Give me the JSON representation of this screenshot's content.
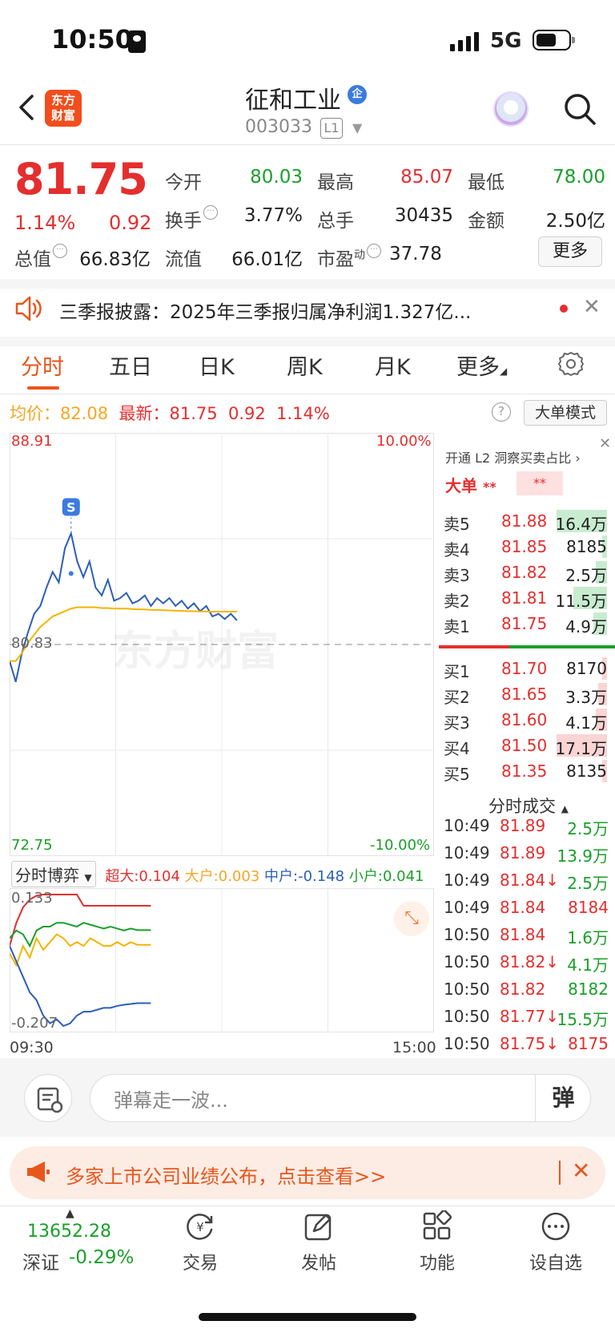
{
  "status_bar": {
    "time": "10:50",
    "network": "5G"
  },
  "header": {
    "brand": "东方财富",
    "stock_name": "征和工业",
    "ent_badge": "企",
    "stock_code": "003033",
    "level": "L1"
  },
  "quote": {
    "price": "81.75",
    "pct_change": "1.14%",
    "abs_change": "0.92",
    "open_label": "今开",
    "open": "80.03",
    "high_label": "最高",
    "high": "85.07",
    "low_label": "最低",
    "low": "78.00",
    "turnover_label": "换手",
    "turnover": "3.77%",
    "volume_label": "总手",
    "volume": "30435",
    "amount_label": "金额",
    "amount": "2.50亿",
    "mcap_label": "总值",
    "mcap": "66.83亿",
    "float_label": "流值",
    "float_cap": "66.01亿",
    "pe_label": "市盈",
    "pe_sup": "动",
    "pe": "37.78",
    "more_label": "更多"
  },
  "notice": {
    "text": "三季报披露：2025年三季报归属净利润1.327亿..."
  },
  "tabs": [
    {
      "label": "分时",
      "active": true
    },
    {
      "label": "五日"
    },
    {
      "label": "日K"
    },
    {
      "label": "周K"
    },
    {
      "label": "月K"
    },
    {
      "label": "更多"
    }
  ],
  "summary": {
    "avg_label": "均价：",
    "avg": "82.08",
    "latest_label": "最新：",
    "latest": "81.75",
    "latest_change": "0.92",
    "latest_pct": "1.14%",
    "help": "?",
    "bigorder_mode": "大单模式"
  },
  "chart_data": {
    "type": "line",
    "y_top": "88.91",
    "y_mid": "80.83",
    "y_bottom": "72.75",
    "pct_top": "10.00%",
    "pct_bottom": "-10.00%",
    "ylim": [
      72.75,
      88.91
    ],
    "marker": "S",
    "watermark": "东方财富",
    "series": [
      {
        "name": "price",
        "color": "#2b5eb7",
        "values": [
          80.2,
          79.4,
          80.5,
          81.3,
          82.0,
          82.3,
          83.0,
          83.6,
          83.2,
          84.5,
          85.07,
          84.0,
          83.4,
          84.0,
          83.0,
          82.7,
          83.3,
          82.5,
          82.6,
          82.8,
          82.4,
          82.5,
          82.7,
          82.3,
          82.6,
          82.4,
          82.6,
          82.3,
          82.5,
          82.2,
          82.4,
          82.1,
          82.3,
          81.9,
          82.0,
          81.8,
          82.0,
          81.75
        ]
      },
      {
        "name": "avg",
        "color": "#f5b400",
        "values": [
          80.2,
          80.2,
          80.5,
          80.9,
          81.2,
          81.5,
          81.7,
          81.9,
          82.0,
          82.1,
          82.2,
          82.25,
          82.25,
          82.25,
          82.25,
          82.22,
          82.22,
          82.2,
          82.2,
          82.2,
          82.18,
          82.17,
          82.17,
          82.15,
          82.15,
          82.14,
          82.13,
          82.12,
          82.11,
          82.1,
          82.1,
          82.09,
          82.09,
          82.08,
          82.08,
          82.08,
          82.08,
          82.08
        ]
      }
    ],
    "x_start": "09:30",
    "x_end": "15:00"
  },
  "flow": {
    "select": "分时博弈",
    "super_label": "超大:",
    "super": "0.104",
    "big_label": "大户:",
    "big": "0.003",
    "mid_label": "中户:",
    "mid": "-0.148",
    "small_label": "小户:",
    "small": "0.041",
    "y_top": "0.133",
    "y_bottom": "-0.207",
    "colors": {
      "super": "#e52e2e",
      "big": "#f5b400",
      "mid": "#2b5eb7",
      "small": "#1a9f2a"
    },
    "series": {
      "super": [
        0.0,
        0.06,
        0.1,
        0.12,
        0.13,
        0.133,
        0.133,
        0.133,
        0.133,
        0.133,
        0.133,
        0.104,
        0.104,
        0.104,
        0.104,
        0.104,
        0.104,
        0.104,
        0.104,
        0.104,
        0.104,
        0.104
      ],
      "big": [
        -0.02,
        -0.05,
        0.0,
        -0.03,
        0.02,
        -0.01,
        0.01,
        0.03,
        0.02,
        0.0,
        0.01,
        0.0,
        0.02,
        0.01,
        0.0,
        0.0,
        0.01,
        0.0,
        0.01,
        0.003,
        0.003,
        0.003
      ],
      "mid": [
        0.0,
        -0.04,
        -0.08,
        -0.12,
        -0.14,
        -0.18,
        -0.2,
        -0.19,
        -0.207,
        -0.2,
        -0.18,
        -0.17,
        -0.17,
        -0.165,
        -0.16,
        -0.16,
        -0.155,
        -0.152,
        -0.15,
        -0.148,
        -0.148,
        -0.148
      ],
      "small": [
        0.02,
        0.04,
        0.03,
        0.0,
        0.04,
        0.05,
        0.05,
        0.06,
        0.06,
        0.055,
        0.05,
        0.06,
        0.055,
        0.05,
        0.045,
        0.05,
        0.045,
        0.04,
        0.045,
        0.041,
        0.041,
        0.041
      ]
    }
  },
  "panel": {
    "promo": "开通 L2 洞察买卖占比 ›",
    "bigorder_label": "大单",
    "bigorder_stars": "**",
    "bigorder_ratio": "**",
    "asks": [
      {
        "label": "卖5",
        "price": "81.88",
        "vol": "16.4万",
        "bar": 0.45,
        "bar_color": "#c8ecd0"
      },
      {
        "label": "卖4",
        "price": "81.85",
        "vol": "8185",
        "bar": 0.02,
        "bar_color": "#c8ecd0"
      },
      {
        "label": "卖3",
        "price": "81.82",
        "vol": "2.5万",
        "bar": 0.1,
        "bar_color": "#c8ecd0"
      },
      {
        "label": "卖2",
        "price": "81.81",
        "vol": "11.5万",
        "bar": 0.3,
        "bar_color": "#c8ecd0"
      },
      {
        "label": "卖1",
        "price": "81.75",
        "vol": "4.9万",
        "bar": 0.12,
        "bar_color": "#c8ecd0"
      }
    ],
    "bids": [
      {
        "label": "买1",
        "price": "81.70",
        "vol": "8170",
        "bar": 0.02,
        "bar_color": "#fbd4d4"
      },
      {
        "label": "买2",
        "price": "81.65",
        "vol": "3.3万",
        "bar": 0.08,
        "bar_color": "#fbd4d4"
      },
      {
        "label": "买3",
        "price": "81.60",
        "vol": "4.1万",
        "bar": 0.1,
        "bar_color": "#fbd4d4"
      },
      {
        "label": "买4",
        "price": "81.50",
        "vol": "17.1万",
        "bar": 0.45,
        "bar_color": "#fbd4d4"
      },
      {
        "label": "买5",
        "price": "81.35",
        "vol": "8135",
        "bar": 0.02,
        "bar_color": "#fbd4d4"
      }
    ],
    "ticks_title": "分时成交",
    "ticks": [
      {
        "time": "10:49",
        "price": "81.89",
        "dir": "",
        "vol": "2.5万",
        "color": "green"
      },
      {
        "time": "10:49",
        "price": "81.89",
        "dir": "",
        "vol": "13.9万",
        "color": "green"
      },
      {
        "time": "10:49",
        "price": "81.84",
        "dir": "↓",
        "vol": "2.5万",
        "color": "green"
      },
      {
        "time": "10:49",
        "price": "81.84",
        "dir": "",
        "vol": "8184",
        "color": "red"
      },
      {
        "time": "10:50",
        "price": "81.84",
        "dir": "",
        "vol": "1.6万",
        "color": "green"
      },
      {
        "time": "10:50",
        "price": "81.82",
        "dir": "↓",
        "vol": "4.1万",
        "color": "green"
      },
      {
        "time": "10:50",
        "price": "81.82",
        "dir": "",
        "vol": "8182",
        "color": "green"
      },
      {
        "time": "10:50",
        "price": "81.77",
        "dir": "↓",
        "vol": "15.5万",
        "color": "green"
      },
      {
        "time": "10:50",
        "price": "81.75",
        "dir": "↓",
        "vol": "8175",
        "color": "red"
      }
    ]
  },
  "danmu": {
    "placeholder": "弹幕走一波...",
    "send": "弹"
  },
  "promo": {
    "text": "多家上市公司业绩公布，点击查看>>"
  },
  "bottom_nav": {
    "index_value": "13652.28",
    "index_name": "深证",
    "index_pct": "-0.29%",
    "items": [
      {
        "label": "交易",
        "icon": "trade-icon"
      },
      {
        "label": "发帖",
        "icon": "post-icon"
      },
      {
        "label": "功能",
        "icon": "function-icon"
      },
      {
        "label": "设自选",
        "icon": "watchlist-icon"
      }
    ]
  }
}
